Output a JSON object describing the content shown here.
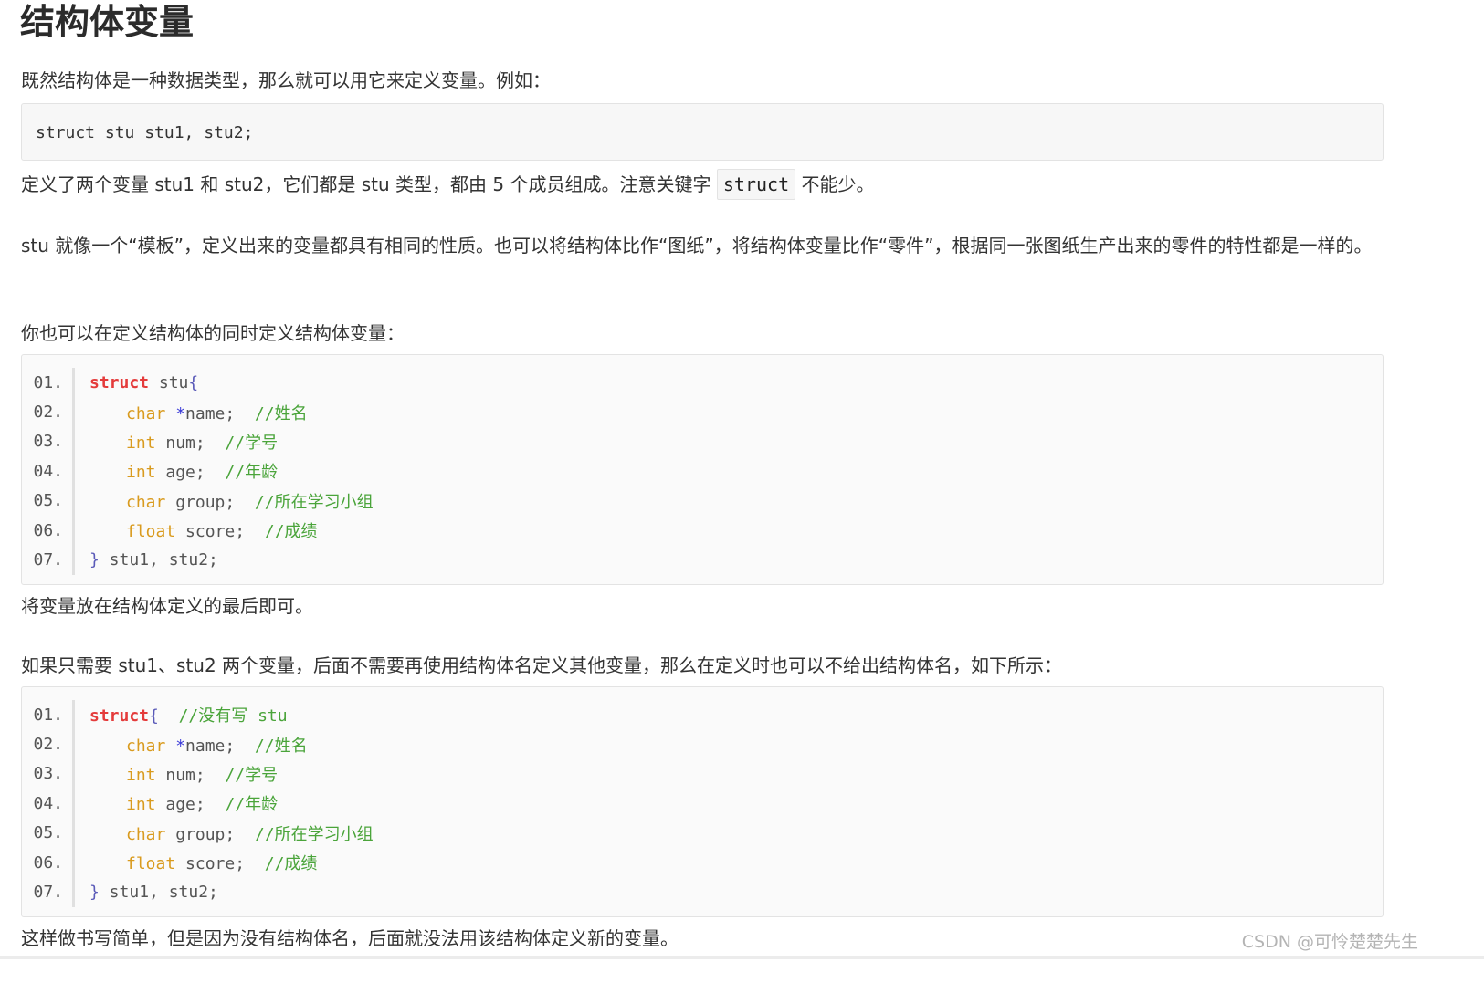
{
  "title": "结构体变量",
  "p1": "既然结构体是一种数据类型，那么就可以用它来定义变量。例如：",
  "code1": "struct stu stu1, stu2;",
  "p2_before": "定义了两个变量 stu1 和 stu2，它们都是 stu 类型，都由 5 个成员组成。注意关键字",
  "p2_code": "struct",
  "p2_after": "不能少。",
  "p3": "stu 就像一个“模板”，定义出来的变量都具有相同的性质。也可以将结构体比作“图纸”，将结构体变量比作“零件”，根据同一张图纸生产出来的零件的特性都是一样的。",
  "p4": "你也可以在定义结构体的同时定义结构体变量：",
  "listing1": {
    "line_numbers": [
      "01.",
      "02.",
      "03.",
      "04.",
      "05.",
      "06.",
      "07."
    ],
    "l1_kw": "struct",
    "l1_rest": " stu",
    "l1_brace": "{",
    "members": [
      {
        "type": "char",
        "ptr": "*",
        "name": "name;",
        "comment": "//姓名"
      },
      {
        "type": "int",
        "ptr": "",
        "name": "num;",
        "comment": "//学号"
      },
      {
        "type": "int",
        "ptr": "",
        "name": "age;",
        "comment": "//年龄"
      },
      {
        "type": "char",
        "ptr": "",
        "name": "group;",
        "comment": "//所在学习小组"
      },
      {
        "type": "float",
        "ptr": "",
        "name": "score;",
        "comment": "//成绩"
      }
    ],
    "close_brace": "}",
    "close_rest": " stu1, stu2;"
  },
  "p5": "将变量放在结构体定义的最后即可。",
  "p6": "如果只需要 stu1、stu2 两个变量，后面不需要再使用结构体名定义其他变量，那么在定义时也可以不给出结构体名，如下所示：",
  "listing2": {
    "l1_kw": "struct",
    "l1_brace": "{",
    "l1_comment": "//没有写 stu"
  },
  "p7": "这样做书写简单，但是因为没有结构体名，后面就没法用该结构体定义新的变量。",
  "watermark": "CSDN @可怜楚楚先生",
  "colors": {
    "keyword": "#e43b3b",
    "type": "#d99b1f",
    "comment": "#4aa43a",
    "operator": "#3a3ad8"
  }
}
